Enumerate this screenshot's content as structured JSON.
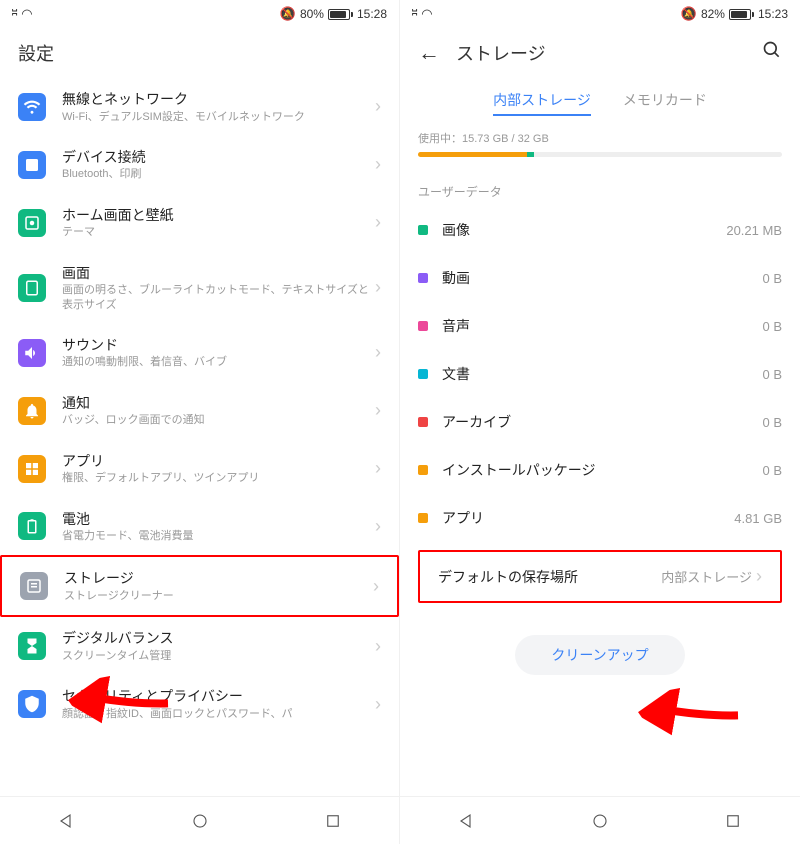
{
  "left": {
    "status": {
      "battery": "80%",
      "time": "15:28"
    },
    "title": "設定",
    "items": [
      {
        "title": "無線とネットワーク",
        "sub": "Wi-Fi、デュアルSIM設定、モバイルネットワーク"
      },
      {
        "title": "デバイス接続",
        "sub": "Bluetooth、印刷"
      },
      {
        "title": "ホーム画面と壁紙",
        "sub": "テーマ"
      },
      {
        "title": "画面",
        "sub": "画面の明るさ、ブルーライトカットモード、テキストサイズと表示サイズ"
      },
      {
        "title": "サウンド",
        "sub": "通知の鳴動制限、着信音、バイブ"
      },
      {
        "title": "通知",
        "sub": "バッジ、ロック画面での通知"
      },
      {
        "title": "アプリ",
        "sub": "権限、デフォルトアプリ、ツインアプリ"
      },
      {
        "title": "電池",
        "sub": "省電力モード、電池消費量"
      },
      {
        "title": "ストレージ",
        "sub": "ストレージクリーナー"
      },
      {
        "title": "デジタルバランス",
        "sub": "スクリーンタイム管理"
      },
      {
        "title": "セキュリティとプライバシー",
        "sub": "顔認証、指紋ID、画面ロックとパスワード、パ"
      }
    ]
  },
  "right": {
    "status": {
      "battery": "82%",
      "time": "15:23"
    },
    "title": "ストレージ",
    "tabs": [
      "内部ストレージ",
      "メモリカード"
    ],
    "usage_label": "使用中：15.73 GB / 32 GB",
    "section_header": "ユーザーデータ",
    "data_items": [
      {
        "label": "画像",
        "value": "20.21 MB",
        "color": "#10b981"
      },
      {
        "label": "動画",
        "value": "0 B",
        "color": "#8b5cf6"
      },
      {
        "label": "音声",
        "value": "0 B",
        "color": "#ec4899"
      },
      {
        "label": "文書",
        "value": "0 B",
        "color": "#06b6d4"
      },
      {
        "label": "アーカイブ",
        "value": "0 B",
        "color": "#ef4444"
      },
      {
        "label": "インストールパッケージ",
        "value": "0 B",
        "color": "#f59e0b"
      },
      {
        "label": "アプリ",
        "value": "4.81 GB",
        "color": "#f59e0b"
      }
    ],
    "default_location": {
      "label": "デフォルトの保存場所",
      "value": "内部ストレージ"
    },
    "cleanup": "クリーンアップ"
  }
}
